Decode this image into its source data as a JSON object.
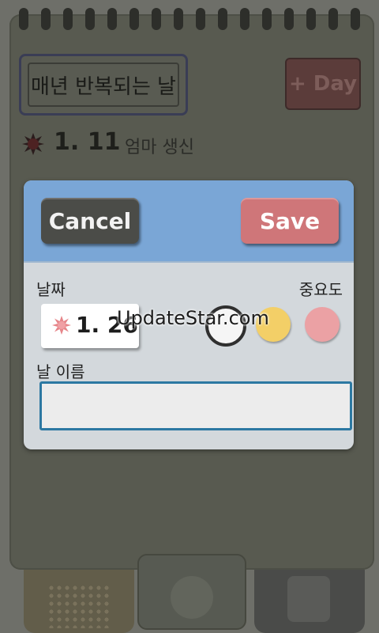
{
  "header": {
    "title": "매년 반복되는 날",
    "add_day_label": "+ Day"
  },
  "event": {
    "date": "1. 11",
    "name": "엄마 생신"
  },
  "dialog": {
    "cancel_label": "Cancel",
    "save_label": "Save",
    "date_label": "날짜",
    "importance_label": "중요도",
    "date_value": "1. 26",
    "name_label": "날 이름",
    "name_value": "",
    "importance_options": [
      "none",
      "yellow",
      "pink"
    ],
    "colors": {
      "header": "#7aa6d6",
      "cancel": "#4b4c48",
      "save": "#cf7679",
      "yellow": "#f3cf67",
      "pink": "#eba1a4",
      "input_border": "#2c78a2"
    }
  },
  "watermark": "UpdateStar.com",
  "bottom_tabs": [
    "grid-icon",
    "home-circle-icon",
    "square-icon"
  ]
}
